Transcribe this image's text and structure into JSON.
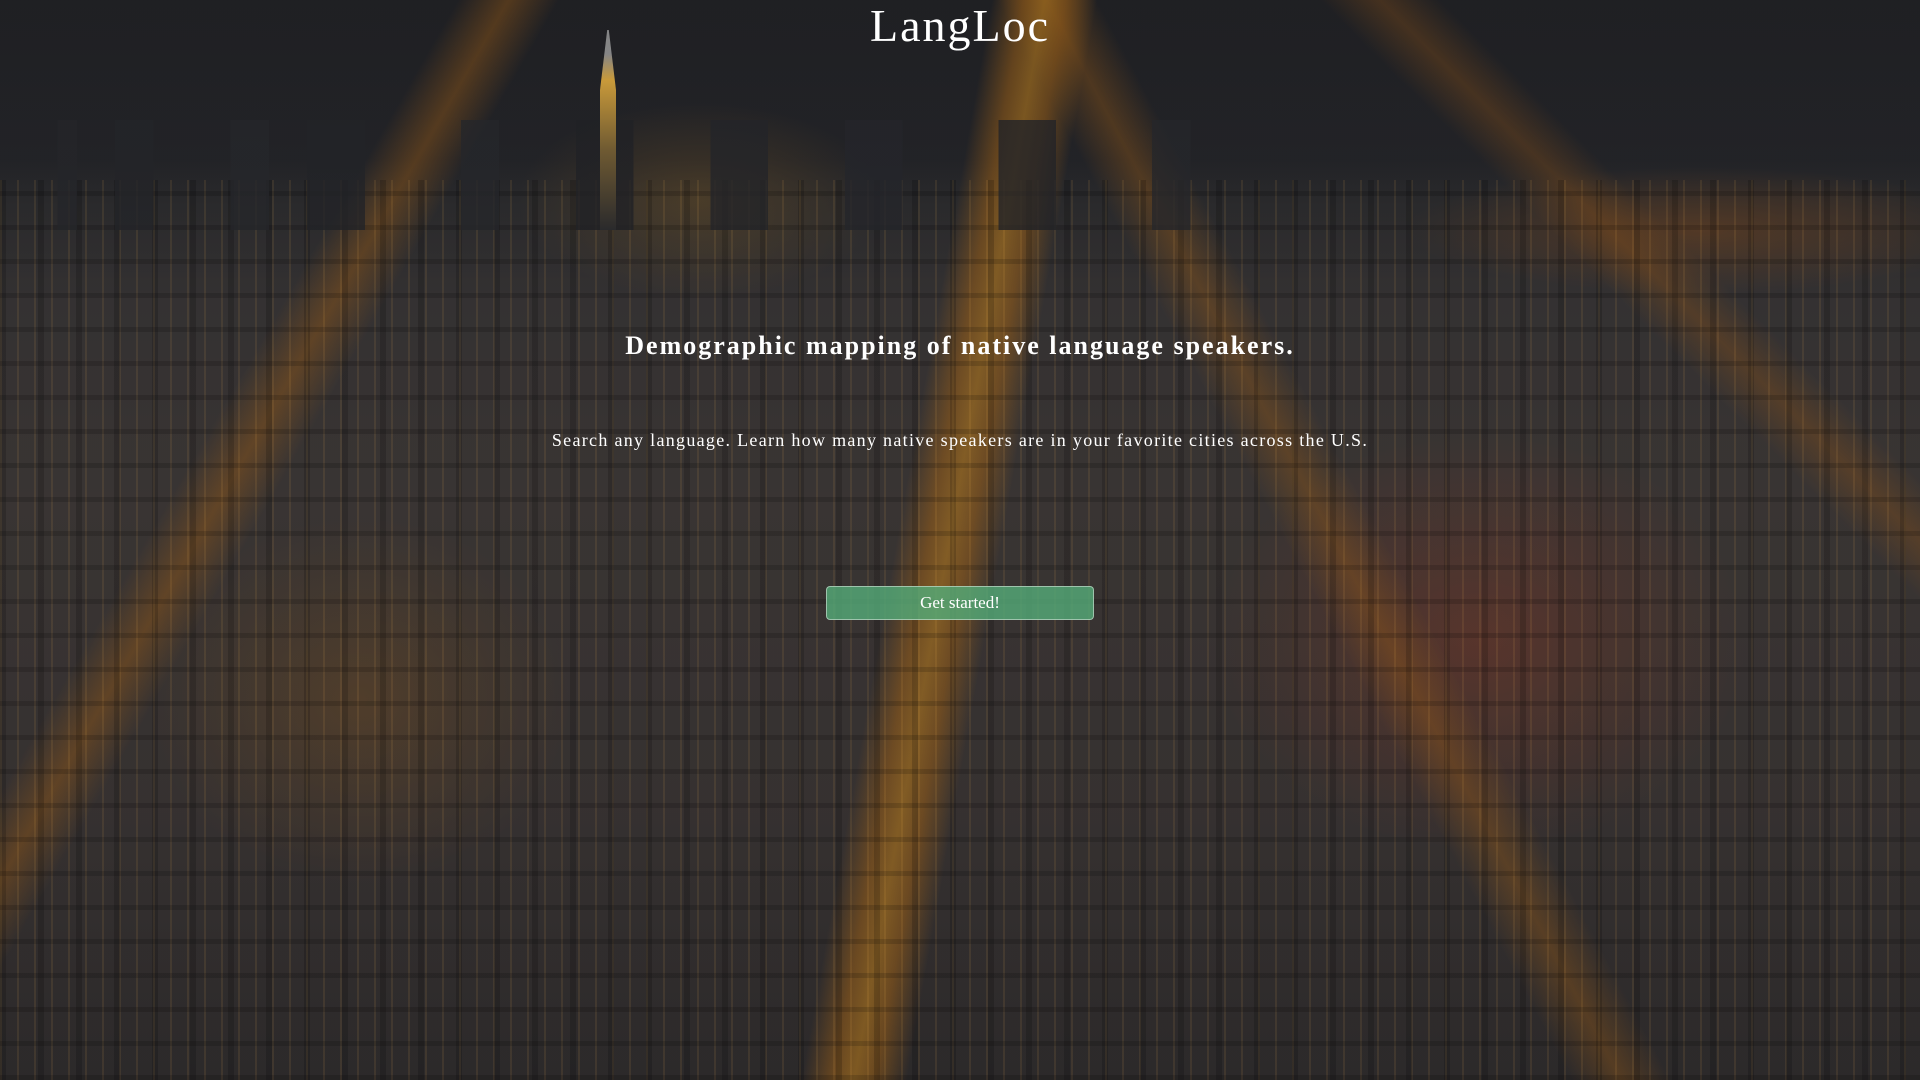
{
  "header": {
    "title": "LangLoc"
  },
  "hero": {
    "subtitle": "Demographic mapping of native language speakers.",
    "tagline": "Search any language. Learn how many native speakers are in your favorite cities across the U.S.",
    "cta_label": "Get started!"
  },
  "colors": {
    "cta_background": "#54aa78",
    "text": "#ffffff"
  }
}
